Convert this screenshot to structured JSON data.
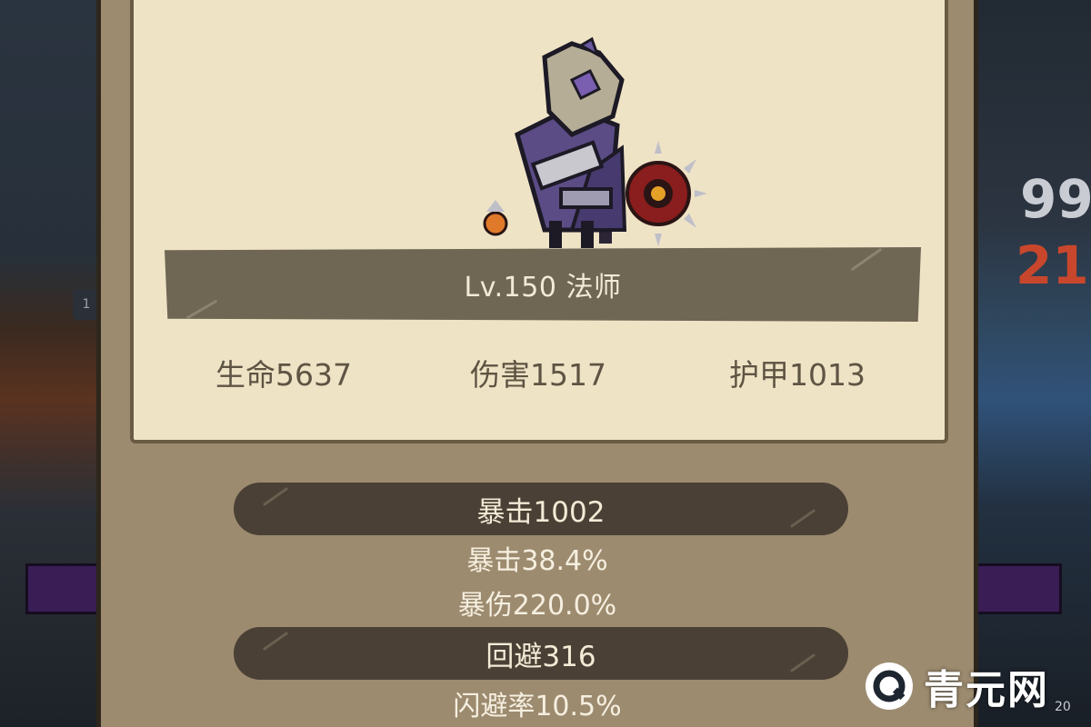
{
  "background": {
    "left_badge": "1",
    "right_numbers": [
      "99",
      "21"
    ],
    "right_small": "20"
  },
  "hero": {
    "level_label": "Lv.150 法师",
    "stats": [
      {
        "label": "生命5637"
      },
      {
        "label": "伤害1517"
      },
      {
        "label": "护甲1013"
      }
    ]
  },
  "crit_section": {
    "header": "暴击1002",
    "lines": [
      "暴击38.4%",
      "暴伤220.0%"
    ]
  },
  "dodge_section": {
    "header": "回避316",
    "lines": [
      "闪避率10.5%"
    ]
  },
  "watermark": {
    "text": "青元网",
    "icon": "q-logo-icon"
  },
  "colors": {
    "panel": "#9c8b6f",
    "card": "#efe3c6",
    "banner": "#6f6654",
    "pill": "#4a4035",
    "stat_text": "#5e5443"
  }
}
